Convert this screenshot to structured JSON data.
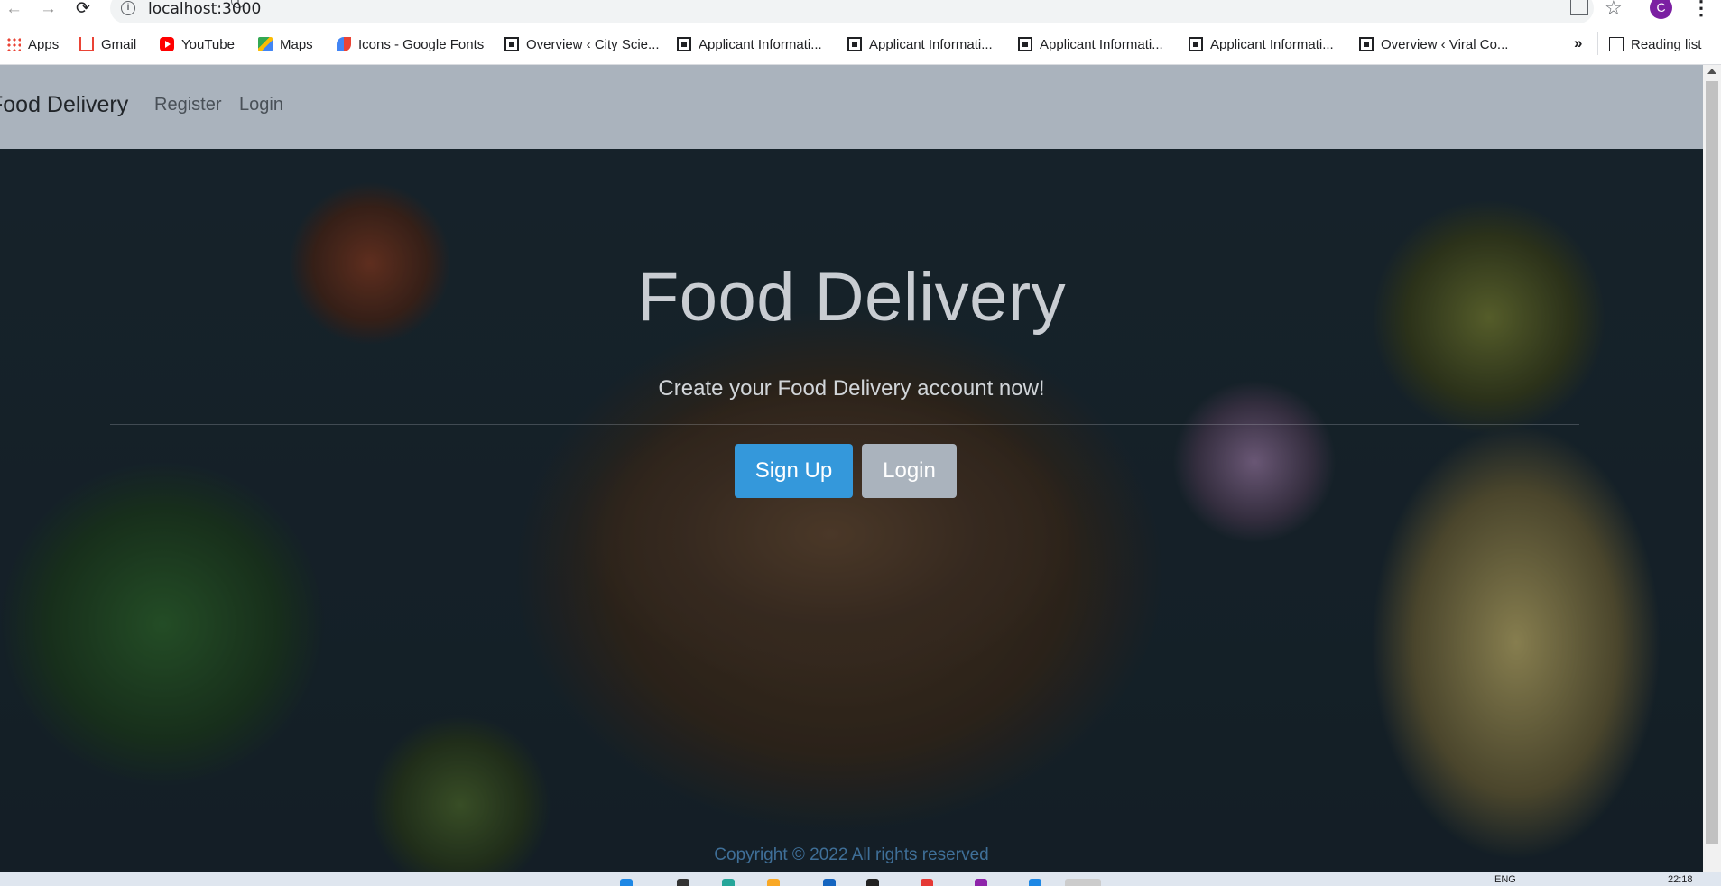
{
  "browser": {
    "url": "localhost:3000",
    "bookmarks": [
      {
        "label": "Apps",
        "icon": "apps-grid-icon"
      },
      {
        "label": "Gmail",
        "icon": "gmail-icon"
      },
      {
        "label": "YouTube",
        "icon": "youtube-icon"
      },
      {
        "label": "Maps",
        "icon": "maps-icon"
      },
      {
        "label": "Icons - Google Fonts",
        "icon": "google-fonts-icon"
      },
      {
        "label": "Overview ‹ City Scie...",
        "icon": "site-icon"
      },
      {
        "label": "Applicant Informati...",
        "icon": "site-icon"
      },
      {
        "label": "Applicant Informati...",
        "icon": "site-icon"
      },
      {
        "label": "Applicant Informati...",
        "icon": "site-icon"
      },
      {
        "label": "Applicant Informati...",
        "icon": "site-icon"
      },
      {
        "label": "Overview ‹ Viral Co...",
        "icon": "site-icon"
      }
    ],
    "more_bookmarks": "»",
    "reading_list": "Reading list",
    "profile_initial": "C"
  },
  "navbar": {
    "brand": "Food Delivery",
    "links": [
      "Register",
      "Login"
    ]
  },
  "hero": {
    "title": "Food Delivery",
    "subtitle": "Create your Food Delivery account now!",
    "signup_label": "Sign Up",
    "login_label": "Login"
  },
  "footer": {
    "copyright": "Copyright © 2022 All rights reserved"
  },
  "taskbar": {
    "lang": "ENG",
    "time": "22:18"
  },
  "colors": {
    "navbar_bg": "#aab3bd",
    "signup_bg": "#3498db",
    "login_bg": "#aab3bd",
    "copyright_text": "#3f6f98"
  }
}
